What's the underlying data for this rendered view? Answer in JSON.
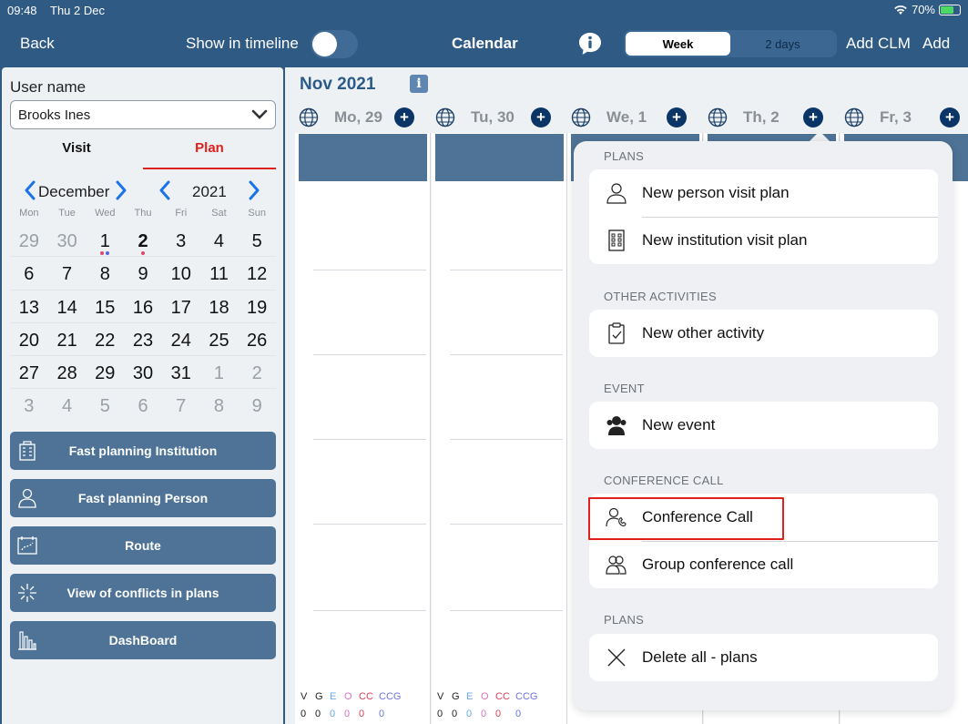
{
  "status": {
    "time": "09:48",
    "date": "Thu 2 Dec",
    "battery": "70%"
  },
  "nav": {
    "back": "Back",
    "timeline_label": "Show in timeline",
    "title": "Calendar",
    "seg_week": "Week",
    "seg_2days": "2 days",
    "add_clm": "Add CLM",
    "add": "Add"
  },
  "left": {
    "user_label": "User name",
    "user_value": "Brooks Ines",
    "tab_visit": "Visit",
    "tab_plan": "Plan",
    "calendar": {
      "month": "December",
      "year": "2021",
      "dow": [
        "Mon",
        "Tue",
        "Wed",
        "Thu",
        "Fri",
        "Sat",
        "Sun"
      ],
      "weeks": [
        [
          "29",
          "30",
          "1",
          "2",
          "3",
          "4",
          "5"
        ],
        [
          "6",
          "7",
          "8",
          "9",
          "10",
          "11",
          "12"
        ],
        [
          "13",
          "14",
          "15",
          "16",
          "17",
          "18",
          "19"
        ],
        [
          "20",
          "21",
          "22",
          "23",
          "24",
          "25",
          "26"
        ],
        [
          "27",
          "28",
          "29",
          "30",
          "31",
          "1",
          "2"
        ],
        [
          "3",
          "4",
          "5",
          "6",
          "7",
          "8",
          "9"
        ]
      ]
    },
    "actions": {
      "fast_inst": "Fast planning Institution",
      "fast_person": "Fast planning Person",
      "route": "Route",
      "conflicts": "View of conflicts in plans",
      "dashboard": "DashBoard"
    }
  },
  "main": {
    "month_label": "Nov 2021",
    "info": "i",
    "days": [
      "Mo, 29",
      "Tu, 30",
      "We, 1",
      "Th, 2",
      "Fr, 3"
    ],
    "plus": "+",
    "legend_top": [
      "V",
      "G",
      "E",
      "O",
      "CC",
      "CCG"
    ],
    "legend_bottom": [
      "0",
      "0",
      "0",
      "0",
      "0",
      "0"
    ]
  },
  "popover": {
    "sec_plans": "PLANS",
    "new_person_plan": "New person visit plan",
    "new_inst_plan": "New institution visit plan",
    "sec_other": "OTHER ACTIVITIES",
    "new_other": "New other activity",
    "sec_event": "EVENT",
    "new_event": "New event",
    "sec_conf": "CONFERENCE CALL",
    "conf_call": "Conference Call",
    "group_conf": "Group conference call",
    "sec_plans2": "PLANS",
    "delete_all": "Delete all  - plans"
  },
  "colors": {
    "nav": "#2f5a84",
    "accent_red": "#e0201b",
    "button": "#4e7396",
    "plus": "#0b3566"
  }
}
